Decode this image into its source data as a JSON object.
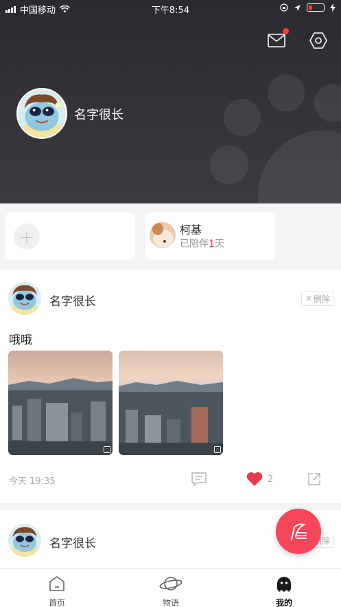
{
  "status_bar": {
    "carrier": "中国移动",
    "time": "下午8:54"
  },
  "profile": {
    "name": "名字很长"
  },
  "pets": [
    {
      "name": "柯基",
      "days_prefix": "已陪伴",
      "days": "1",
      "days_suffix": "天"
    }
  ],
  "posts": [
    {
      "author": "名字很长",
      "delete_label": "删除",
      "text": "哦哦",
      "time": "今天 19:35",
      "likes": "2"
    },
    {
      "author": "名字很长",
      "delete_label": "删除"
    }
  ],
  "tabs": [
    {
      "label": "首页",
      "icon": "home-icon"
    },
    {
      "label": "物语",
      "icon": "planet-icon"
    },
    {
      "label": "我的",
      "icon": "profile-icon",
      "active": true
    }
  ],
  "colors": {
    "accent": "#f7455a",
    "like": "#f0384c",
    "header_bg": "#2f2f34",
    "notification_dot": "#ff3b3b"
  }
}
